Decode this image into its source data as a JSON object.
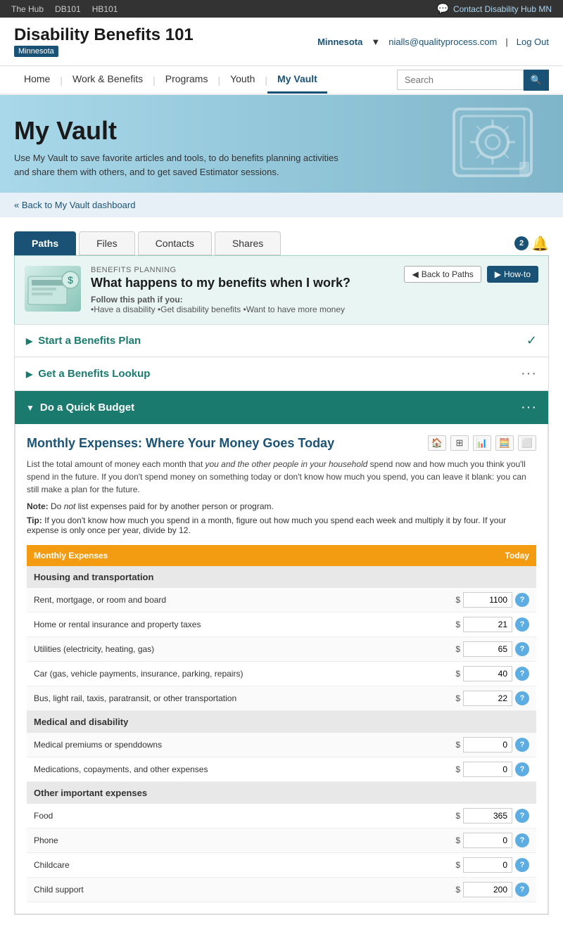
{
  "topbar": {
    "links": [
      "The Hub",
      "DB101",
      "HB101"
    ],
    "contact": "Contact Disability Hub MN"
  },
  "header": {
    "title": "Disability Benefits 101",
    "subtitle": "Minnesota",
    "state": "Minnesota",
    "email": "nialls@qualityprocess.com",
    "logout": "Log Out"
  },
  "nav": {
    "links": [
      "Home",
      "Work & Benefits",
      "Programs",
      "Youth",
      "My Vault"
    ],
    "active": "My Vault",
    "search_placeholder": "Search"
  },
  "hero": {
    "title": "My Vault",
    "description": "Use My Vault to save favorite articles and tools, to do benefits planning activities and share them with others, and to get saved Estimator sessions."
  },
  "breadcrumb": {
    "text": "« Back to My Vault dashboard",
    "link": "#"
  },
  "tabs": {
    "items": [
      "Paths",
      "Files",
      "Contacts",
      "Shares"
    ],
    "active": "Paths",
    "notification_count": "2"
  },
  "path_card": {
    "label": "BENEFITS PLANNING",
    "title": "What happens to my benefits when I work?",
    "follow_text": "Follow this path if you:",
    "bullets": "•Have a disability  •Get disability benefits  •Want to have more money",
    "back_btn": "Back to Paths",
    "howto_btn": "How-to"
  },
  "accordions": [
    {
      "title": "Start a Benefits Plan",
      "active": false,
      "icon_right": "✓",
      "icon_right_type": "check"
    },
    {
      "title": "Get a Benefits Lookup",
      "active": false,
      "icon_right": "···",
      "icon_right_type": "dots"
    },
    {
      "title": "Do a Quick Budget",
      "active": true,
      "icon_right": "···",
      "icon_right_type": "dots"
    }
  ],
  "budget": {
    "title": "Monthly Expenses: Where Your Money Goes Today",
    "description": "List the total amount of money each month that you and the other people in your household spend now and how much you think you'll spend in the future. If you don't spend money on something today or don't know how much you spend, you can leave it blank: you can still make a plan for the future.",
    "note": "Note: Do not list expenses paid for by another person or program.",
    "tip": "Tip: If you don't know how much you spend in a month, figure out how much you spend each week and multiply it by four. If your expense is only once per year, divide by 12.",
    "table_header": {
      "col1": "Monthly Expenses",
      "col2": "Today"
    },
    "sections": [
      {
        "name": "Housing and transportation",
        "rows": [
          {
            "label": "Rent, mortgage, or room and board",
            "value": "1100"
          },
          {
            "label": "Home or rental insurance and property taxes",
            "value": "21"
          },
          {
            "label": "Utilities (electricity, heating, gas)",
            "value": "65"
          },
          {
            "label": "Car (gas, vehicle payments, insurance, parking, repairs)",
            "value": "40"
          },
          {
            "label": "Bus, light rail, taxis, paratransit, or other transportation",
            "value": "22"
          }
        ]
      },
      {
        "name": "Medical and disability",
        "rows": [
          {
            "label": "Medical premiums or spenddowns",
            "value": "0"
          },
          {
            "label": "Medications, copayments, and other expenses",
            "value": "0"
          }
        ]
      },
      {
        "name": "Other important expenses",
        "rows": [
          {
            "label": "Food",
            "value": "365"
          },
          {
            "label": "Phone",
            "value": "0"
          },
          {
            "label": "Childcare",
            "value": "0"
          },
          {
            "label": "Child support",
            "value": "200"
          }
        ]
      }
    ]
  }
}
